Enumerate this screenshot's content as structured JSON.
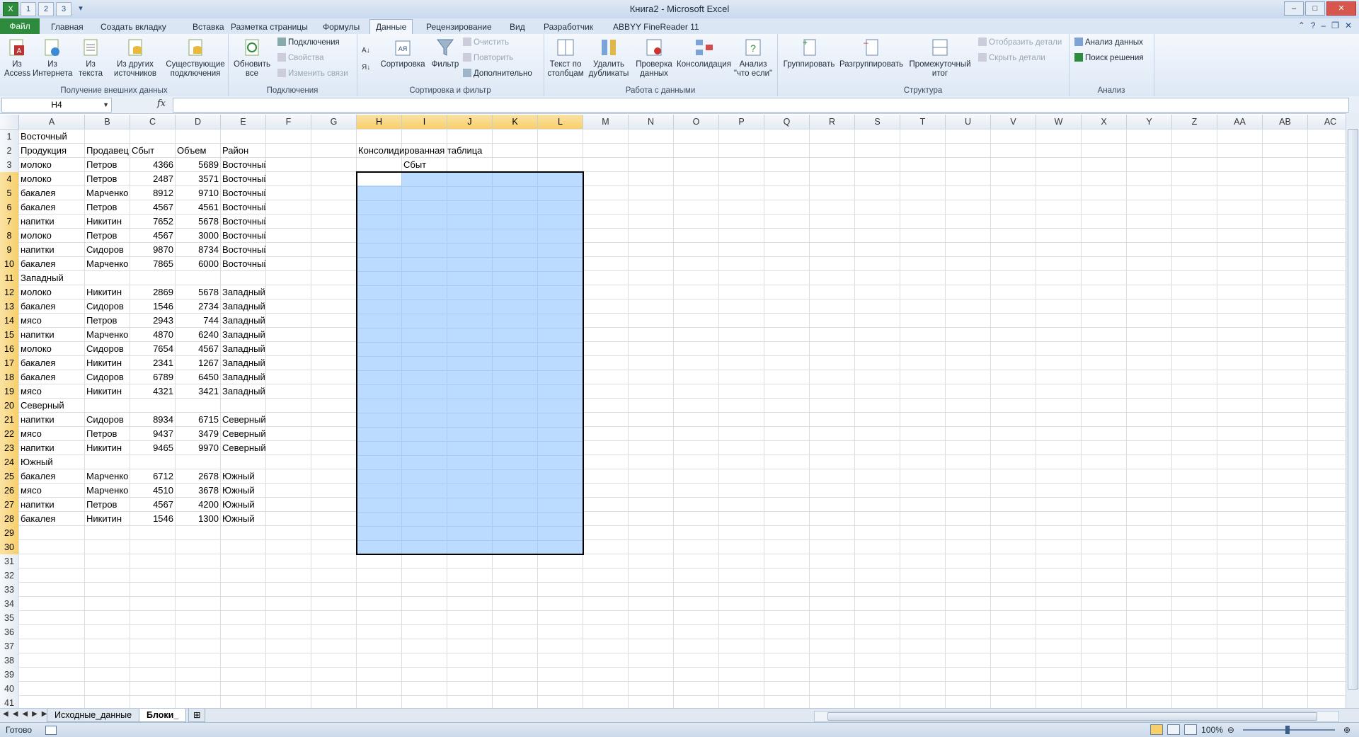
{
  "window": {
    "title": "Книга2 - Microsoft Excel",
    "qat": [
      "1",
      "2",
      "3"
    ],
    "controls": [
      "–",
      "□",
      "✕"
    ]
  },
  "tabs": [
    {
      "label": "Файл",
      "key": "Ф"
    },
    {
      "label": "Главная",
      "key": "Я"
    },
    {
      "label": "Создать вкладку",
      "key": "Э1"
    },
    {
      "label": "Вставка",
      "key": "С"
    },
    {
      "label": "Разметка страницы",
      "key": "З"
    },
    {
      "label": "Формулы",
      "key": "Л"
    },
    {
      "label": "Данные",
      "key": "Ы"
    },
    {
      "label": "Рецензирование",
      "key": "Р"
    },
    {
      "label": "Вид",
      "key": "О"
    },
    {
      "label": "Разработчик",
      "key": "Ч"
    },
    {
      "label": "ABBYY FineReader 11",
      "key": "Э2"
    }
  ],
  "ribbon": {
    "external": {
      "label": "Получение внешних данных",
      "from_access": "Из\nAccess",
      "from_web": "Из\nИнтернета",
      "from_text": "Из\nтекста",
      "from_other": "Из других\nисточников",
      "existing": "Существующие\nподключения"
    },
    "connections": {
      "label": "Подключения",
      "refresh": "Обновить\nвсе",
      "connections": "Подключения",
      "properties": "Свойства",
      "edit_links": "Изменить связи"
    },
    "sort": {
      "label": "Сортировка и фильтр",
      "sort": "Сортировка",
      "filter": "Фильтр",
      "clear": "Очистить",
      "reapply": "Повторить",
      "advanced": "Дополнительно"
    },
    "tools": {
      "label": "Работа с данными",
      "text_to_columns": "Текст по\nстолбцам",
      "remove_duplicates": "Удалить\nдубликаты",
      "validation": "Проверка\nданных",
      "consolidate": "Консолидация",
      "whatif": "Анализ\n\"что если\""
    },
    "outline": {
      "label": "Структура",
      "group": "Группировать",
      "ungroup": "Разгруппировать",
      "subtotal": "Промежуточный\nитог",
      "show_detail": "Отобразить детали",
      "hide_detail": "Скрыть детали"
    },
    "analysis": {
      "label": "Анализ",
      "data_analysis": "Анализ данных",
      "solver": "Поиск решения"
    }
  },
  "formula_bar": {
    "name_box": "H4",
    "fx": "fx",
    "content": ""
  },
  "columns": [
    "A",
    "B",
    "C",
    "D",
    "E",
    "F",
    "G",
    "H",
    "I",
    "J",
    "K",
    "L",
    "M",
    "N",
    "O",
    "P",
    "Q",
    "R",
    "S",
    "T",
    "U",
    "V",
    "W",
    "X",
    "Y",
    "Z",
    "AA",
    "AB",
    "AC"
  ],
  "rows": [
    "1",
    "2",
    "3",
    "4",
    "5",
    "6",
    "7",
    "8",
    "9",
    "10",
    "11",
    "12",
    "13",
    "14",
    "15",
    "16",
    "17",
    "18",
    "19",
    "20",
    "21",
    "22",
    "23",
    "24",
    "25",
    "26",
    "27",
    "28",
    "29",
    "30",
    "31",
    "32",
    "33",
    "34",
    "35",
    "36",
    "37",
    "38",
    "39",
    "40",
    "41"
  ],
  "cells": [
    {
      "r": 1,
      "c": 0,
      "v": "Восточный"
    },
    {
      "r": 2,
      "c": 0,
      "v": "Продукция"
    },
    {
      "r": 2,
      "c": 1,
      "v": "Продавец"
    },
    {
      "r": 2,
      "c": 2,
      "v": "Сбыт"
    },
    {
      "r": 2,
      "c": 3,
      "v": "Объем"
    },
    {
      "r": 2,
      "c": 4,
      "v": "Район"
    },
    {
      "r": 2,
      "c": 7,
      "v": "Консолидированная таблица"
    },
    {
      "r": 3,
      "c": 8,
      "v": "Сбыт"
    },
    {
      "r": 3,
      "c": 0,
      "v": "молоко"
    },
    {
      "r": 3,
      "c": 1,
      "v": "Петров"
    },
    {
      "r": 3,
      "c": 2,
      "v": "4366",
      "n": true
    },
    {
      "r": 3,
      "c": 3,
      "v": "5689",
      "n": true
    },
    {
      "r": 3,
      "c": 4,
      "v": "Восточный"
    },
    {
      "r": 4,
      "c": 0,
      "v": "молоко"
    },
    {
      "r": 4,
      "c": 1,
      "v": "Петров"
    },
    {
      "r": 4,
      "c": 2,
      "v": "2487",
      "n": true
    },
    {
      "r": 4,
      "c": 3,
      "v": "3571",
      "n": true
    },
    {
      "r": 4,
      "c": 4,
      "v": "Восточный"
    },
    {
      "r": 5,
      "c": 0,
      "v": "бакалея"
    },
    {
      "r": 5,
      "c": 1,
      "v": "Марченко"
    },
    {
      "r": 5,
      "c": 2,
      "v": "8912",
      "n": true
    },
    {
      "r": 5,
      "c": 3,
      "v": "9710",
      "n": true
    },
    {
      "r": 5,
      "c": 4,
      "v": "Восточный"
    },
    {
      "r": 6,
      "c": 0,
      "v": "бакалея"
    },
    {
      "r": 6,
      "c": 1,
      "v": "Петров"
    },
    {
      "r": 6,
      "c": 2,
      "v": "4567",
      "n": true
    },
    {
      "r": 6,
      "c": 3,
      "v": "4561",
      "n": true
    },
    {
      "r": 6,
      "c": 4,
      "v": "Восточный"
    },
    {
      "r": 7,
      "c": 0,
      "v": "напитки"
    },
    {
      "r": 7,
      "c": 1,
      "v": "Никитин"
    },
    {
      "r": 7,
      "c": 2,
      "v": "7652",
      "n": true
    },
    {
      "r": 7,
      "c": 3,
      "v": "5678",
      "n": true
    },
    {
      "r": 7,
      "c": 4,
      "v": "Восточный"
    },
    {
      "r": 8,
      "c": 0,
      "v": "молоко"
    },
    {
      "r": 8,
      "c": 1,
      "v": "Петров"
    },
    {
      "r": 8,
      "c": 2,
      "v": "4567",
      "n": true
    },
    {
      "r": 8,
      "c": 3,
      "v": "3000",
      "n": true
    },
    {
      "r": 8,
      "c": 4,
      "v": "Восточный"
    },
    {
      "r": 9,
      "c": 0,
      "v": "напитки"
    },
    {
      "r": 9,
      "c": 1,
      "v": "Сидоров"
    },
    {
      "r": 9,
      "c": 2,
      "v": "9870",
      "n": true
    },
    {
      "r": 9,
      "c": 3,
      "v": "8734",
      "n": true
    },
    {
      "r": 9,
      "c": 4,
      "v": "Восточный"
    },
    {
      "r": 10,
      "c": 0,
      "v": "бакалея"
    },
    {
      "r": 10,
      "c": 1,
      "v": "Марченко"
    },
    {
      "r": 10,
      "c": 2,
      "v": "7865",
      "n": true
    },
    {
      "r": 10,
      "c": 3,
      "v": "6000",
      "n": true
    },
    {
      "r": 10,
      "c": 4,
      "v": "Восточный"
    },
    {
      "r": 11,
      "c": 0,
      "v": "Западный"
    },
    {
      "r": 12,
      "c": 0,
      "v": "молоко"
    },
    {
      "r": 12,
      "c": 1,
      "v": "Никитин"
    },
    {
      "r": 12,
      "c": 2,
      "v": "2869",
      "n": true
    },
    {
      "r": 12,
      "c": 3,
      "v": "5678",
      "n": true
    },
    {
      "r": 12,
      "c": 4,
      "v": "Западный"
    },
    {
      "r": 13,
      "c": 0,
      "v": "бакалея"
    },
    {
      "r": 13,
      "c": 1,
      "v": "Сидоров"
    },
    {
      "r": 13,
      "c": 2,
      "v": "1546",
      "n": true
    },
    {
      "r": 13,
      "c": 3,
      "v": "2734",
      "n": true
    },
    {
      "r": 13,
      "c": 4,
      "v": "Западный"
    },
    {
      "r": 14,
      "c": 0,
      "v": "мясо"
    },
    {
      "r": 14,
      "c": 1,
      "v": "Петров"
    },
    {
      "r": 14,
      "c": 2,
      "v": "2943",
      "n": true
    },
    {
      "r": 14,
      "c": 3,
      "v": "744",
      "n": true
    },
    {
      "r": 14,
      "c": 4,
      "v": "Западный"
    },
    {
      "r": 15,
      "c": 0,
      "v": "напитки"
    },
    {
      "r": 15,
      "c": 1,
      "v": "Марченко"
    },
    {
      "r": 15,
      "c": 2,
      "v": "4870",
      "n": true
    },
    {
      "r": 15,
      "c": 3,
      "v": "6240",
      "n": true
    },
    {
      "r": 15,
      "c": 4,
      "v": "Западный"
    },
    {
      "r": 16,
      "c": 0,
      "v": "молоко"
    },
    {
      "r": 16,
      "c": 1,
      "v": "Сидоров"
    },
    {
      "r": 16,
      "c": 2,
      "v": "7654",
      "n": true
    },
    {
      "r": 16,
      "c": 3,
      "v": "4567",
      "n": true
    },
    {
      "r": 16,
      "c": 4,
      "v": "Западный"
    },
    {
      "r": 17,
      "c": 0,
      "v": "бакалея"
    },
    {
      "r": 17,
      "c": 1,
      "v": "Никитин"
    },
    {
      "r": 17,
      "c": 2,
      "v": "2341",
      "n": true
    },
    {
      "r": 17,
      "c": 3,
      "v": "1267",
      "n": true
    },
    {
      "r": 17,
      "c": 4,
      "v": "Западный"
    },
    {
      "r": 18,
      "c": 0,
      "v": "бакалея"
    },
    {
      "r": 18,
      "c": 1,
      "v": "Сидоров"
    },
    {
      "r": 18,
      "c": 2,
      "v": "6789",
      "n": true
    },
    {
      "r": 18,
      "c": 3,
      "v": "6450",
      "n": true
    },
    {
      "r": 18,
      "c": 4,
      "v": "Западный"
    },
    {
      "r": 19,
      "c": 0,
      "v": "мясо"
    },
    {
      "r": 19,
      "c": 1,
      "v": "Никитин"
    },
    {
      "r": 19,
      "c": 2,
      "v": "4321",
      "n": true
    },
    {
      "r": 19,
      "c": 3,
      "v": "3421",
      "n": true
    },
    {
      "r": 19,
      "c": 4,
      "v": "Западный"
    },
    {
      "r": 20,
      "c": 0,
      "v": "Северный"
    },
    {
      "r": 21,
      "c": 0,
      "v": "напитки"
    },
    {
      "r": 21,
      "c": 1,
      "v": "Сидоров"
    },
    {
      "r": 21,
      "c": 2,
      "v": "8934",
      "n": true
    },
    {
      "r": 21,
      "c": 3,
      "v": "6715",
      "n": true
    },
    {
      "r": 21,
      "c": 4,
      "v": "Северный"
    },
    {
      "r": 22,
      "c": 0,
      "v": "мясо"
    },
    {
      "r": 22,
      "c": 1,
      "v": "Петров"
    },
    {
      "r": 22,
      "c": 2,
      "v": "9437",
      "n": true
    },
    {
      "r": 22,
      "c": 3,
      "v": "3479",
      "n": true
    },
    {
      "r": 22,
      "c": 4,
      "v": "Северный"
    },
    {
      "r": 23,
      "c": 0,
      "v": "напитки"
    },
    {
      "r": 23,
      "c": 1,
      "v": "Никитин"
    },
    {
      "r": 23,
      "c": 2,
      "v": "9465",
      "n": true
    },
    {
      "r": 23,
      "c": 3,
      "v": "9970",
      "n": true
    },
    {
      "r": 23,
      "c": 4,
      "v": "Северный"
    },
    {
      "r": 24,
      "c": 0,
      "v": "Южный"
    },
    {
      "r": 25,
      "c": 0,
      "v": "бакалея"
    },
    {
      "r": 25,
      "c": 1,
      "v": "Марченко"
    },
    {
      "r": 25,
      "c": 2,
      "v": "6712",
      "n": true
    },
    {
      "r": 25,
      "c": 3,
      "v": "2678",
      "n": true
    },
    {
      "r": 25,
      "c": 4,
      "v": "Южный"
    },
    {
      "r": 26,
      "c": 0,
      "v": "мясо"
    },
    {
      "r": 26,
      "c": 1,
      "v": "Марченко"
    },
    {
      "r": 26,
      "c": 2,
      "v": "4510",
      "n": true
    },
    {
      "r": 26,
      "c": 3,
      "v": "3678",
      "n": true
    },
    {
      "r": 26,
      "c": 4,
      "v": "Южный"
    },
    {
      "r": 27,
      "c": 0,
      "v": "напитки"
    },
    {
      "r": 27,
      "c": 1,
      "v": "Петров"
    },
    {
      "r": 27,
      "c": 2,
      "v": "4567",
      "n": true
    },
    {
      "r": 27,
      "c": 3,
      "v": "4200",
      "n": true
    },
    {
      "r": 27,
      "c": 4,
      "v": "Южный"
    },
    {
      "r": 28,
      "c": 0,
      "v": "бакалея"
    },
    {
      "r": 28,
      "c": 1,
      "v": "Никитин"
    },
    {
      "r": 28,
      "c": 2,
      "v": "1546",
      "n": true
    },
    {
      "r": 28,
      "c": 3,
      "v": "1300",
      "n": true
    },
    {
      "r": 28,
      "c": 4,
      "v": "Южный"
    }
  ],
  "selection": {
    "range": "H4:L30",
    "active": "H4"
  },
  "sheets": [
    {
      "label": "Исходные_данные",
      "active": false
    },
    {
      "label": "Блоки_",
      "active": true
    }
  ],
  "status": {
    "ready": "Готово",
    "zoom": "100%"
  },
  "colors": {
    "file_tab": "#2e8b3d",
    "selection_fill": "#bcdcff",
    "header_highlight": "#f7cf6b"
  }
}
